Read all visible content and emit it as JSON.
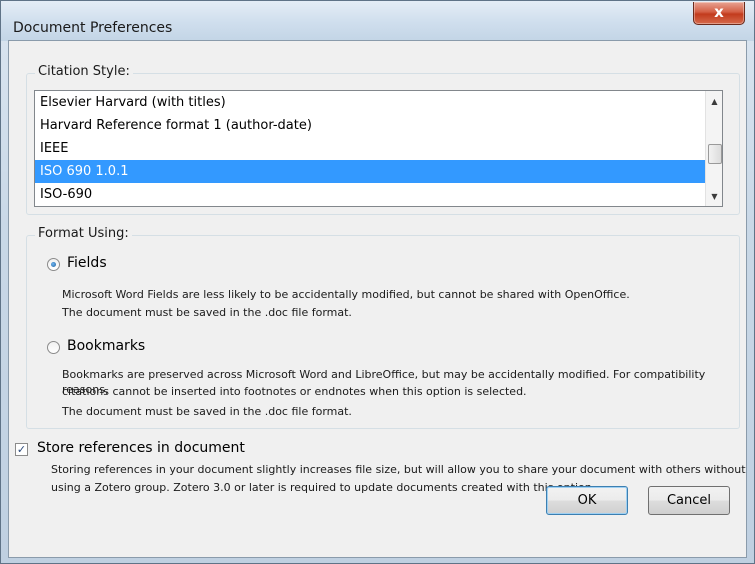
{
  "window": {
    "title": "Document Preferences",
    "close_glyph": "x"
  },
  "citation_style": {
    "label": "Citation Style:",
    "items": [
      "Elsevier Harvard (with titles)",
      "Harvard Reference format 1 (author-date)",
      "IEEE",
      "ISO 690 1.0.1",
      "ISO-690"
    ],
    "selected_index": 3,
    "scroll_up": "▲",
    "scroll_down": "▼"
  },
  "format_using": {
    "label": "Format Using:",
    "fields": {
      "label": "Fields",
      "selected": true,
      "desc1": "Microsoft Word Fields are less likely to be accidentally modified, but cannot be shared with OpenOffice.",
      "desc2": "The document must be saved in the .doc file format."
    },
    "bookmarks": {
      "label": "Bookmarks",
      "selected": false,
      "desc1": "Bookmarks are preserved across Microsoft Word and LibreOffice, but may be accidentally modified. For compatibility reasons,",
      "desc2": "citations cannot be inserted into footnotes or endnotes when this option is selected.",
      "desc3": "The document must be saved in the .doc file format."
    }
  },
  "store_refs": {
    "label": "Store references in document",
    "checked": true,
    "check_glyph": "✓",
    "desc1": "Storing references in your document slightly increases file size, but will allow you to share your document with others without",
    "desc2": "using a Zotero group. Zotero 3.0 or later is required to update documents created with this option."
  },
  "buttons": {
    "ok": "OK",
    "cancel": "Cancel"
  },
  "colors": {
    "selection": "#3399ff",
    "close_red": "#c23b1d"
  }
}
